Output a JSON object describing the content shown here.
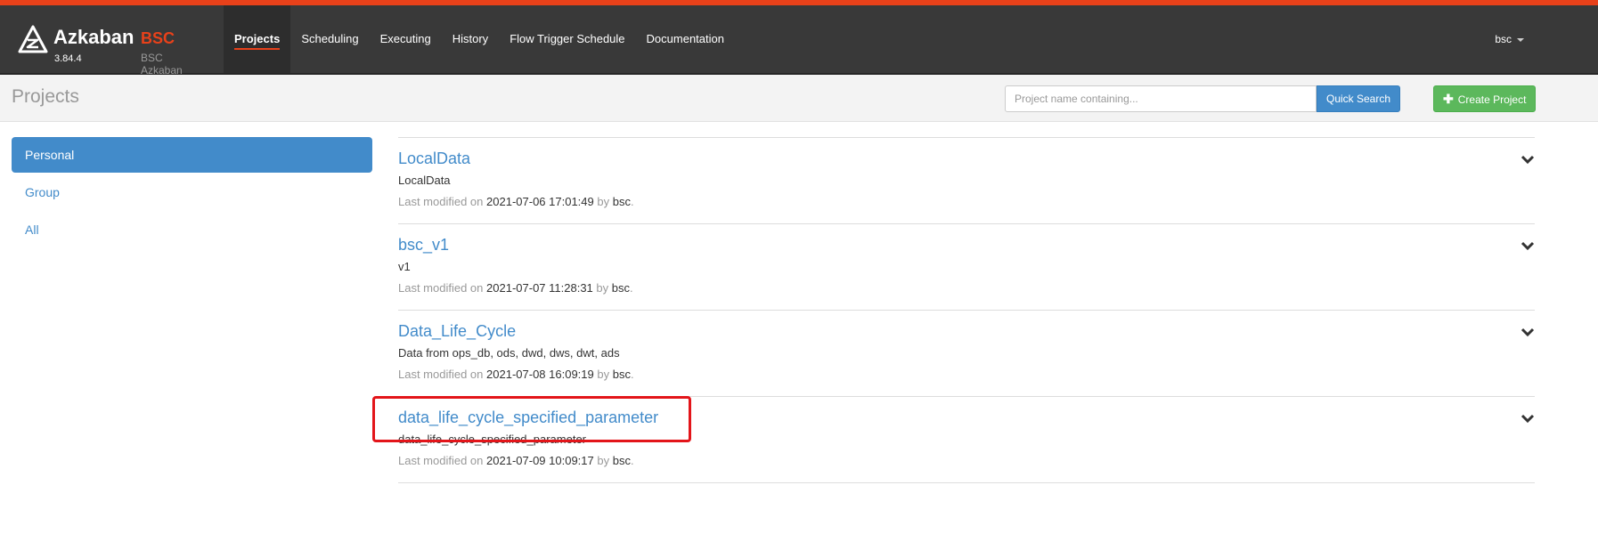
{
  "brand": {
    "name": "Azkaban",
    "version": "3.84.4",
    "env": "BSC",
    "env_sub": "BSC Azkaban"
  },
  "nav": {
    "items": [
      {
        "label": "Projects",
        "active": true
      },
      {
        "label": "Scheduling"
      },
      {
        "label": "Executing"
      },
      {
        "label": "History"
      },
      {
        "label": "Flow Trigger Schedule"
      },
      {
        "label": "Documentation"
      }
    ],
    "user": "bsc"
  },
  "header": {
    "title": "Projects",
    "search_placeholder": "Project name containing...",
    "search_button": "Quick Search",
    "create_button": "Create Project"
  },
  "sidebar": {
    "items": [
      {
        "label": "Personal",
        "active": true
      },
      {
        "label": "Group"
      },
      {
        "label": "All"
      }
    ]
  },
  "projects": [
    {
      "name": "LocalData",
      "description": "LocalData",
      "modified_prefix": "Last modified on",
      "modified_time": "2021-07-06 17:01:49",
      "by": "by",
      "user": "bsc",
      "dot": "."
    },
    {
      "name": "bsc_v1",
      "description": "v1",
      "modified_prefix": "Last modified on",
      "modified_time": "2021-07-07 11:28:31",
      "by": "by",
      "user": "bsc",
      "dot": "."
    },
    {
      "name": "Data_Life_Cycle",
      "description": "Data from ops_db, ods, dwd, dws, dwt, ads",
      "modified_prefix": "Last modified on",
      "modified_time": "2021-07-08 16:09:19",
      "by": "by",
      "user": "bsc",
      "dot": "."
    },
    {
      "name": "data_life_cycle_specified_parameter",
      "description": "data_life_cycle_specified_parameter",
      "modified_prefix": "Last modified on",
      "modified_time": "2021-07-09 10:09:17",
      "by": "by",
      "user": "bsc",
      "dot": "."
    }
  ],
  "colors": {
    "accent": "#e8411a",
    "primary": "#428bca",
    "success": "#5cb85c",
    "navbar": "#393939",
    "highlight": "#e3151a"
  }
}
